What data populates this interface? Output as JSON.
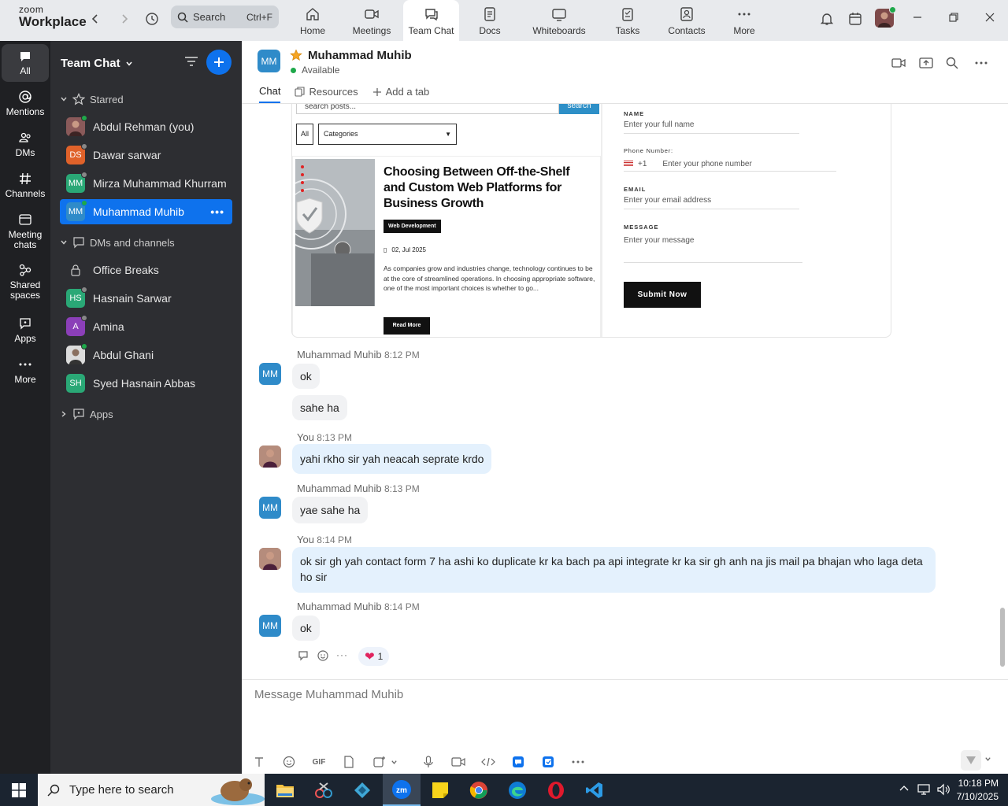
{
  "app": {
    "brand_top": "zoom",
    "brand_bottom": "Workplace",
    "search_placeholder": "Search",
    "search_shortcut": "Ctrl+F"
  },
  "nav_tabs": [
    {
      "label": "Home",
      "icon": "home-icon"
    },
    {
      "label": "Meetings",
      "icon": "video-icon"
    },
    {
      "label": "Team Chat",
      "icon": "chat-icon"
    },
    {
      "label": "Docs",
      "icon": "doc-icon"
    },
    {
      "label": "Whiteboards",
      "icon": "whiteboard-icon"
    },
    {
      "label": "Tasks",
      "icon": "tasks-icon"
    },
    {
      "label": "Contacts",
      "icon": "contacts-icon"
    },
    {
      "label": "More",
      "icon": "more-icon"
    }
  ],
  "rail": [
    {
      "label": "All"
    },
    {
      "label": "Mentions"
    },
    {
      "label": "DMs"
    },
    {
      "label": "Channels"
    },
    {
      "label": "Meeting chats"
    },
    {
      "label": "Shared spaces"
    },
    {
      "label": "Apps"
    },
    {
      "label": "More"
    }
  ],
  "sidebar": {
    "title": "Team Chat",
    "starred_label": "Starred",
    "starred": [
      {
        "name": "Abdul Rehman (you)",
        "initials": "",
        "color": "#8a5a5a",
        "status": "#1ea84a"
      },
      {
        "name": "Dawar sarwar",
        "initials": "DS",
        "color": "#e0622a",
        "status": "#888888"
      },
      {
        "name": "Mirza Muhammad Khurram",
        "initials": "MM",
        "color": "#2aa876",
        "status": "#888888"
      },
      {
        "name": "Muhammad Muhib",
        "initials": "MM",
        "color": "#2f8bc9",
        "status": "#1ea84a"
      }
    ],
    "dms_label": "DMs and channels",
    "dms": [
      {
        "name": "Office Breaks",
        "initials": "",
        "color": "",
        "status": ""
      },
      {
        "name": "Hasnain Sarwar",
        "initials": "HS",
        "color": "#2aa876",
        "status": "#888888"
      },
      {
        "name": "Amina",
        "initials": "A",
        "color": "#8b3fb8",
        "status": "#888888"
      },
      {
        "name": "Abdul Ghani",
        "initials": "",
        "color": "#555555",
        "status": "#1ea84a"
      },
      {
        "name": "Syed Hasnain Abbas",
        "initials": "SH",
        "color": "#2aa876",
        "status": "#888888"
      }
    ],
    "apps_label": "Apps"
  },
  "header": {
    "initials": "MM",
    "name": "Muhammad Muhib",
    "status": "Available",
    "tabs": [
      "Chat",
      "Resources",
      "Add a tab"
    ]
  },
  "webshot": {
    "search_placeholder": "search posts...",
    "search_btn": "search",
    "filter_all": "All",
    "filter_categories": "Categories",
    "post_title": "Choosing Between Off-the-Shelf and Custom Web Platforms for Business Growth",
    "post_tag": "Web Development",
    "post_date": "02, Jul 2025",
    "post_excerpt": "As companies grow and industries change, technology continues to be at the core of streamlined operations. In choosing appropriate software, one of the most important choices is whether to go...",
    "read_more": "Read More",
    "name_label": "NAME",
    "name_ph": "Enter your full name",
    "phone_label": "Phone Number:",
    "phone_code": "+1",
    "phone_ph": "Enter your phone number",
    "email_label": "EMAIL",
    "email_ph": "Enter your email address",
    "message_label": "MESSAGE",
    "message_ph": "Enter your message",
    "submit": "Submit Now"
  },
  "messages": [
    {
      "sender": "Muhammad Muhib",
      "time": "8:12 PM",
      "texts": [
        "ok",
        "sahe ha"
      ]
    },
    {
      "sender": "You",
      "time": "8:13 PM",
      "texts": [
        "yahi rkho sir yah neacah seprate krdo"
      ]
    },
    {
      "sender": "Muhammad Muhib",
      "time": "8:13 PM",
      "texts": [
        "yae sahe ha"
      ]
    },
    {
      "sender": "You",
      "time": "8:14 PM",
      "texts": [
        "ok sir gh yah contact form 7 ha ashi ko duplicate kr ka bach pa api integrate kr ka sir gh anh na jis mail pa bhajan who laga deta ho sir"
      ]
    },
    {
      "sender": "Muhammad Muhib",
      "time": "8:14 PM",
      "texts": [
        "ok"
      ]
    }
  ],
  "reaction": {
    "emoji": "❤",
    "count": "1"
  },
  "composer": {
    "placeholder": "Message Muhammad Muhib",
    "gif": "GIF"
  },
  "taskbar": {
    "search_placeholder": "Type here to search",
    "time": "10:18 PM",
    "date": "7/10/2025"
  }
}
